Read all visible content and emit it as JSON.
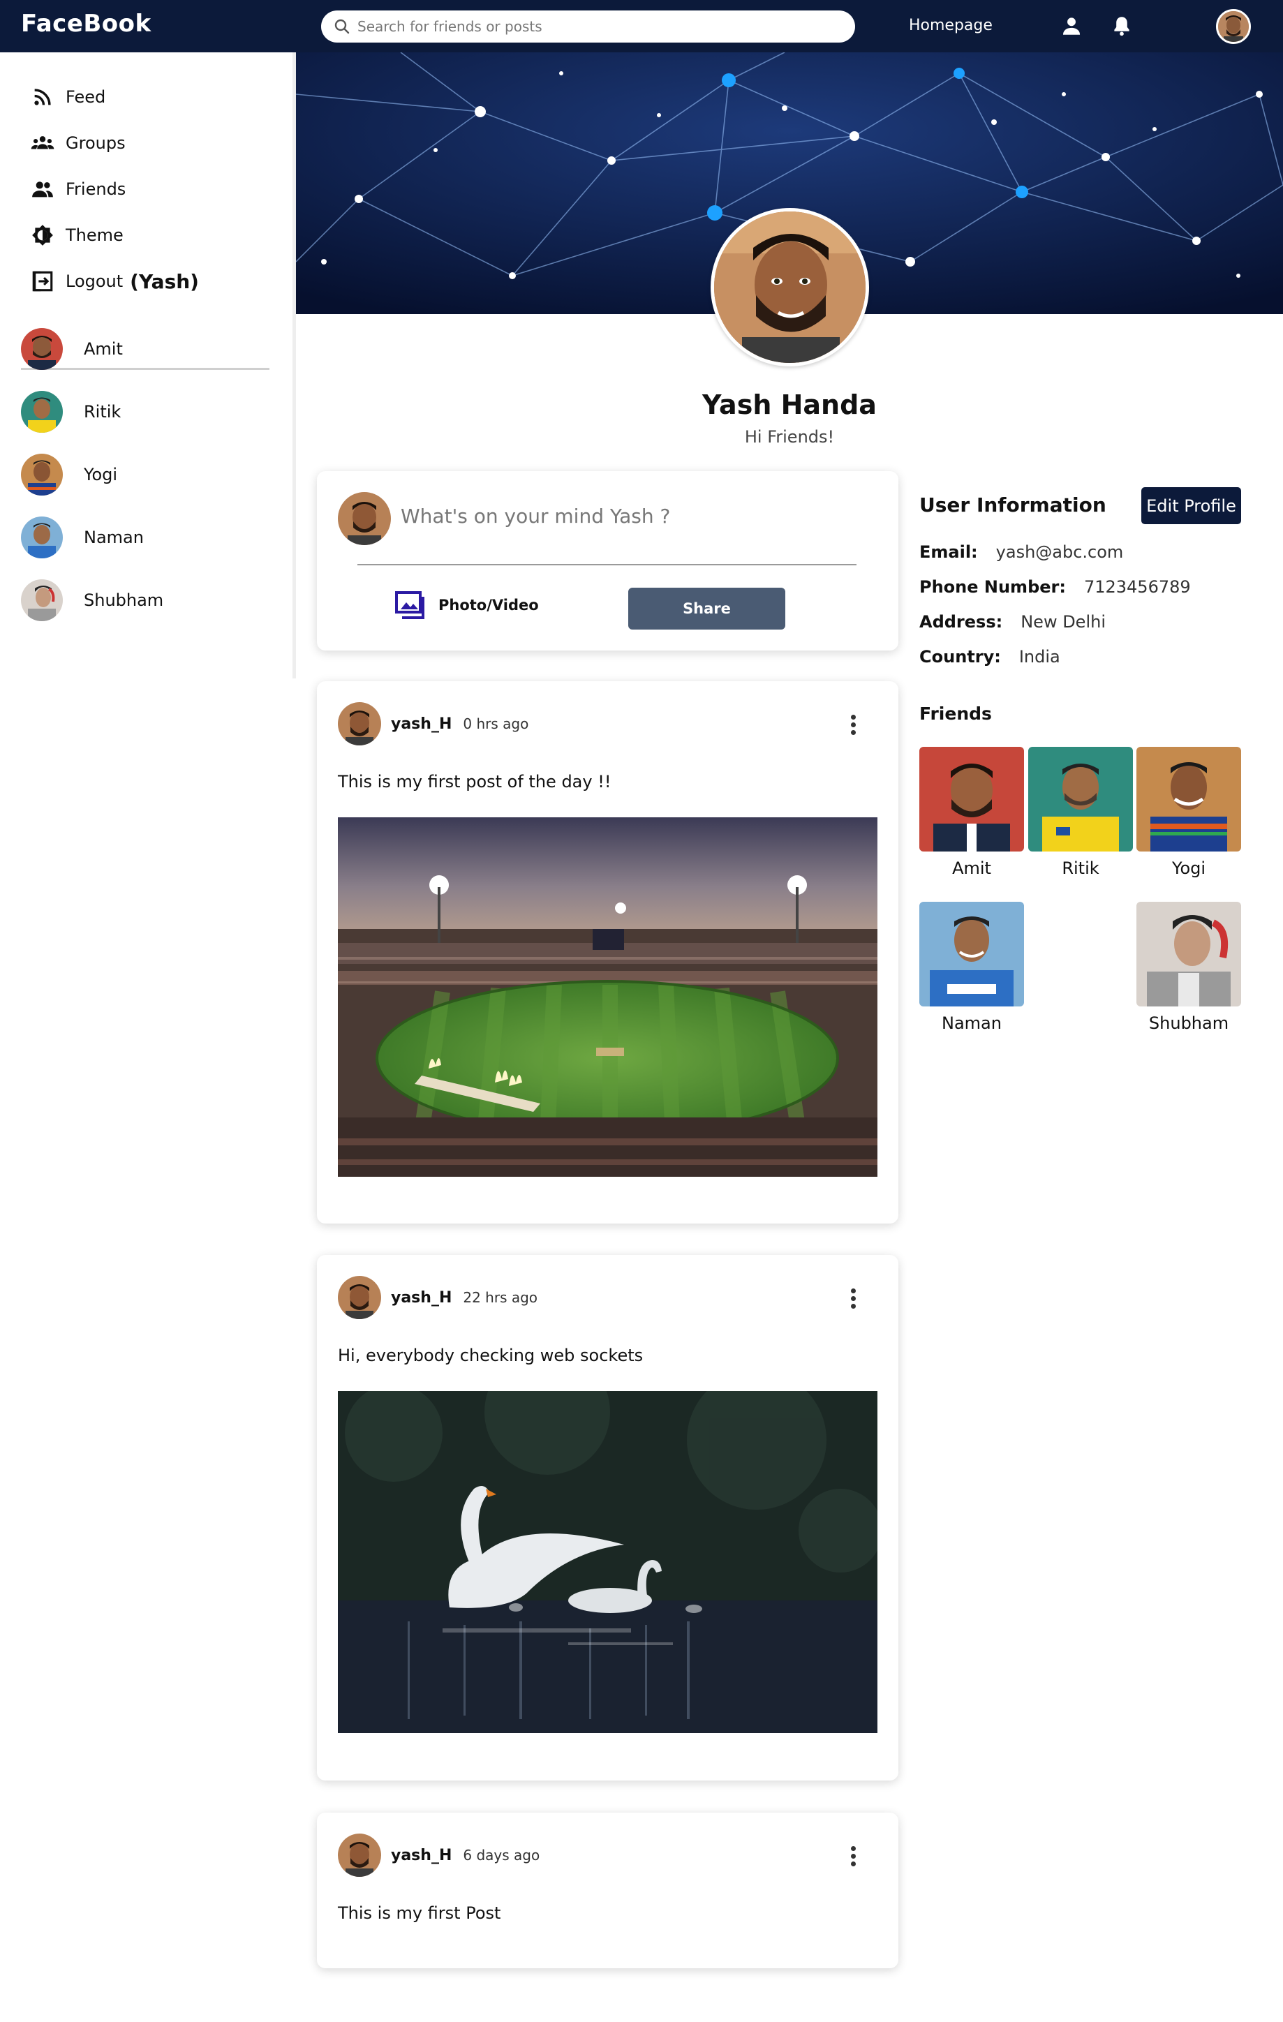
{
  "navbar": {
    "logo": "FaceBook",
    "search_placeholder": "Search for friends or posts",
    "homepage_link": "Homepage",
    "icons": [
      "search-icon",
      "person-icon",
      "bell-icon"
    ]
  },
  "sidebar": {
    "menu": [
      {
        "label": "Feed",
        "icon": "rss-feed-icon"
      },
      {
        "label": "Groups",
        "icon": "groups-icon"
      },
      {
        "label": "Friends",
        "icon": "friends-icon"
      },
      {
        "label": "Theme",
        "icon": "theme-icon"
      }
    ],
    "logout": {
      "label": "Logout",
      "user": "(Yash)",
      "icon": "logout-icon"
    },
    "friends": [
      {
        "name": "Amit"
      },
      {
        "name": "Ritik"
      },
      {
        "name": "Yogi"
      },
      {
        "name": "Naman"
      },
      {
        "name": "Shubham"
      }
    ]
  },
  "profile": {
    "name": "Yash Handa",
    "bio": "Hi Friends!"
  },
  "share": {
    "placeholder": "What's on your mind Yash ?",
    "photo_label": "Photo/Video",
    "share_label": "Share"
  },
  "posts": [
    {
      "user": "yash_H",
      "time": "0 hrs ago",
      "text": "This is my first post of the day !!",
      "image": "cricket-stadium"
    },
    {
      "user": "yash_H",
      "time": "22 hrs ago",
      "text": "Hi, everybody checking web sockets",
      "image": "swans-on-lake"
    },
    {
      "user": "yash_H",
      "time": "6 days ago",
      "text": "This is my first Post",
      "image": null
    }
  ],
  "user_info": {
    "title": "User Information",
    "edit_label": "Edit Profile",
    "fields": [
      {
        "key": "Email:",
        "value": "yash@abc.com"
      },
      {
        "key": "Phone Number:",
        "value": "7123456789"
      },
      {
        "key": "Address:",
        "value": "New Delhi"
      },
      {
        "key": "Country:",
        "value": "India"
      }
    ],
    "friends_title": "Friends",
    "friends": [
      {
        "name": "Amit"
      },
      {
        "name": "Ritik"
      },
      {
        "name": "Yogi"
      },
      {
        "name": "Naman"
      },
      {
        "name": "Shubham"
      }
    ]
  },
  "colors": {
    "navbar": "#0c1a3a",
    "share_button": "#4a5b73",
    "photo_icon": "#2b1aa3"
  }
}
